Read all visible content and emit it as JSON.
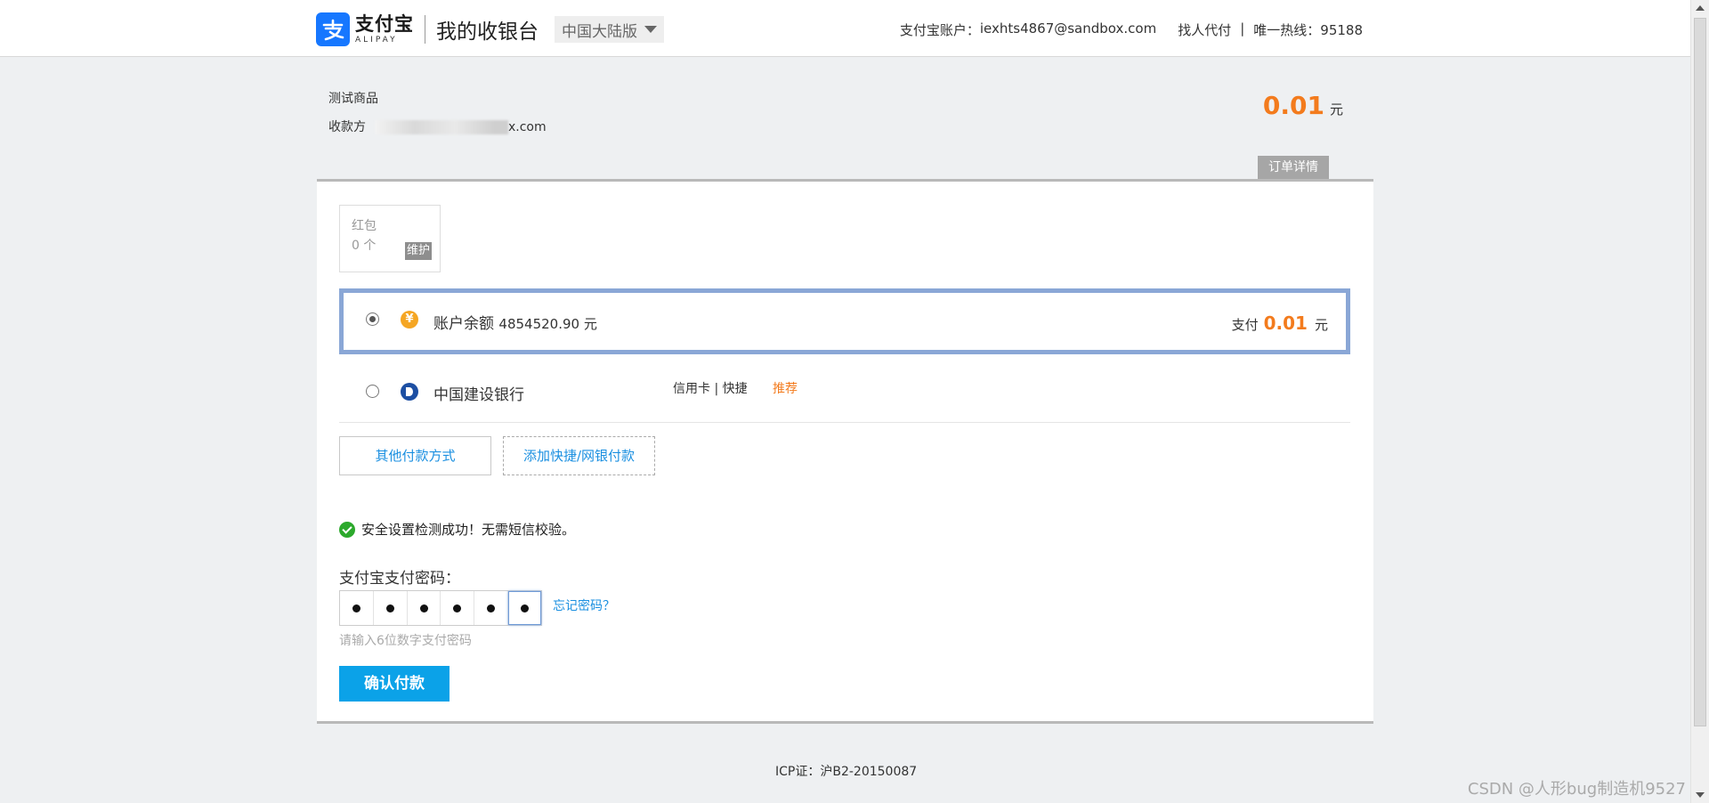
{
  "header": {
    "logo_cn": "支付宝",
    "logo_en": "ALIPAY",
    "title": "我的收银台",
    "region": "中国大陆版",
    "account_label": "支付宝账户：",
    "account": "iexhts4867@sandbox.com",
    "proxy_pay": "找人代付",
    "hotline": "唯一热线：95188"
  },
  "order": {
    "product_name": "测试商品",
    "payee_label": "收款方",
    "payee_suffix": "x.com",
    "amount": "0.01",
    "currency": "元",
    "detail_button": "订单详情"
  },
  "red_packet": {
    "title": "红包",
    "count": "0 个",
    "tag": "维护"
  },
  "payment_methods": [
    {
      "name": "账户余额",
      "balance": "4854520.90 元",
      "pay_label": "支付",
      "pay_amount": "0.01",
      "pay_currency": "元",
      "selected": true,
      "icon": "yuan-coin-icon",
      "icon_glyph": "¥"
    },
    {
      "name": "中国建设银行",
      "tags": "信用卡 | 快捷",
      "badge": "推荐",
      "selected": false,
      "icon": "ccb-bank-icon"
    }
  ],
  "buttons": {
    "other_methods": "其他付款方式",
    "add_method": "添加快捷/网银付款",
    "confirm": "确认付款"
  },
  "security": {
    "message": "安全设置检测成功！无需短信校验。",
    "password_label": "支付宝支付密码：",
    "forgot": "忘记密码？",
    "hint": "请输入6位数字支付密码",
    "digits_filled": 6
  },
  "footer": {
    "icp": "ICP证：沪B2-20150087",
    "watermark": "CSDN @人形bug制造机9527"
  },
  "colors": {
    "accent_orange": "#f37b1d",
    "link_blue": "#1a8fe0",
    "confirm_blue": "#0ba2e8",
    "selected_border": "#8aa7d6"
  }
}
